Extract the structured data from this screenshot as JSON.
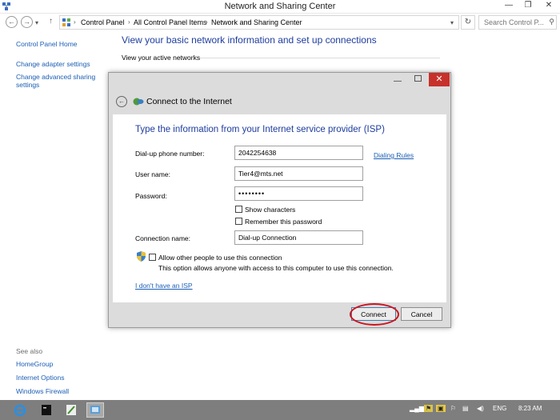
{
  "window": {
    "title": "Network and Sharing Center",
    "controls": {
      "minimize": "—",
      "restore": "❐",
      "close": "✕"
    }
  },
  "address_bar": {
    "breadcrumbs": [
      "Control Panel",
      "All Control Panel Items",
      "Network and Sharing Center"
    ],
    "search_placeholder": "Search Control P..."
  },
  "left_nav": {
    "items": [
      "Control Panel Home",
      "Change adapter settings",
      "Change advanced sharing settings"
    ]
  },
  "see_also": {
    "header": "See also",
    "items": [
      "HomeGroup",
      "Internet Options",
      "Windows Firewall"
    ]
  },
  "main": {
    "heading": "View your basic network information and set up connections",
    "active_networks_label": "View your active networks"
  },
  "dialog": {
    "caption": "Connect to the Internet",
    "heading": "Type the information from your Internet service provider (ISP)",
    "fields": {
      "phone": {
        "label": "Dial-up phone number:",
        "value": "2042254638"
      },
      "user": {
        "label": "User name:",
        "value": "Tier4@mts.net"
      },
      "password": {
        "label": "Password:",
        "value": "••••••••"
      },
      "connection": {
        "label": "Connection name:",
        "value": "Dial-up Connection"
      }
    },
    "dialing_rules_link": "Dialing Rules",
    "show_characters": "Show characters",
    "remember_password": "Remember this password",
    "allow_others": "Allow other people to use this connection",
    "allow_others_desc": "This option allows anyone with access to this computer to use this connection.",
    "no_isp_link": "I don't have an ISP",
    "connect_button": "Connect",
    "cancel_button": "Cancel"
  },
  "taskbar": {
    "language": "ENG",
    "clock": "8:23 AM"
  },
  "colors": {
    "link": "#1c5fb5",
    "heading": "#1e3d9e",
    "close_red": "#c7312b",
    "annotation_ring": "#d0131d",
    "taskbar": "#7e7e7e"
  }
}
